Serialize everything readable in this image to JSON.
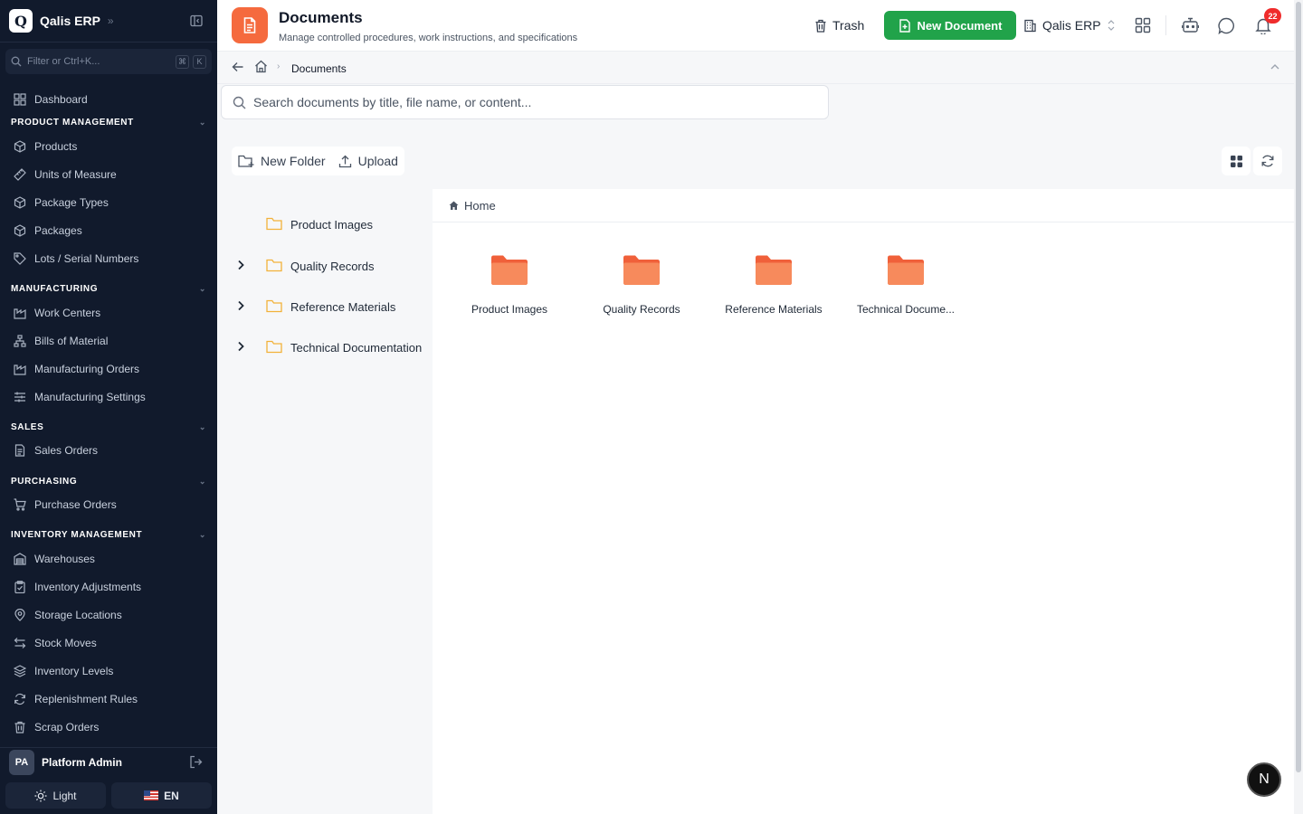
{
  "app": {
    "name": "Qalis ERP",
    "logo_letter": "Q",
    "filter_placeholder": "Filter or Ctrl+K...",
    "filter_keys": [
      "⌘",
      "K"
    ]
  },
  "sidebar": {
    "dashboard": "Dashboard",
    "sections": [
      {
        "title": "PRODUCT MANAGEMENT",
        "items": [
          "Products",
          "Units of Measure",
          "Package Types",
          "Packages",
          "Lots / Serial Numbers"
        ]
      },
      {
        "title": "MANUFACTURING",
        "items": [
          "Work Centers",
          "Bills of Material",
          "Manufacturing Orders",
          "Manufacturing Settings"
        ]
      },
      {
        "title": "SALES",
        "items": [
          "Sales Orders"
        ]
      },
      {
        "title": "PURCHASING",
        "items": [
          "Purchase Orders"
        ]
      },
      {
        "title": "INVENTORY MANAGEMENT",
        "items": [
          "Warehouses",
          "Inventory Adjustments",
          "Storage Locations",
          "Stock Moves",
          "Inventory Levels",
          "Replenishment Rules",
          "Scrap Orders"
        ]
      }
    ],
    "user": {
      "initials": "PA",
      "name": "Platform Admin"
    },
    "theme_label": "Light",
    "lang_label": "EN"
  },
  "header": {
    "title": "Documents",
    "subtitle": "Manage controlled procedures, work instructions, and specifications",
    "trash_label": "Trash",
    "new_document_label": "New Document",
    "company": "Qalis ERP",
    "notification_count": "22"
  },
  "breadcrumb": {
    "current": "Documents"
  },
  "search": {
    "placeholder": "Search documents by title, file name, or content..."
  },
  "toolbar": {
    "new_folder_label": "New Folder",
    "upload_label": "Upload"
  },
  "tree": [
    {
      "label": "Product Images",
      "expandable": false
    },
    {
      "label": "Quality Records",
      "expandable": true
    },
    {
      "label": "Reference Materials",
      "expandable": true
    },
    {
      "label": "Technical Documentation",
      "expandable": true
    }
  ],
  "content": {
    "crumb": "Home",
    "folders": [
      "Product Images",
      "Quality Records",
      "Reference Materials",
      "Technical Docume..."
    ]
  },
  "fab_letter": "N",
  "colors": {
    "sidebar_bg": "#111a2c",
    "accent_orange": "#f56a3e",
    "folder_outline": "#f2b23a",
    "primary_green": "#21a34a",
    "badge_red": "#ef2c2c"
  }
}
